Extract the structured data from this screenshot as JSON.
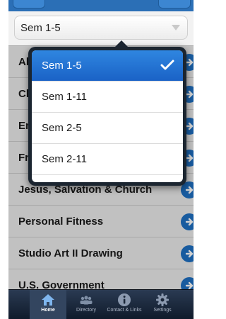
{
  "selector": {
    "value": "Sem 1-5"
  },
  "courses": [
    {
      "label": "Al"
    },
    {
      "label": "Ch"
    },
    {
      "label": "En"
    },
    {
      "label": "Fr"
    },
    {
      "label": "Jesus, Salvation & Church"
    },
    {
      "label": "Personal Fitness"
    },
    {
      "label": "Studio Art II Drawing"
    },
    {
      "label": "U.S. Government"
    }
  ],
  "dropdown": {
    "options": [
      {
        "label": "Sem 1-5",
        "selected": true
      },
      {
        "label": "Sem 1-11",
        "selected": false
      },
      {
        "label": "Sem 2-5",
        "selected": false
      },
      {
        "label": "Sem 2-11",
        "selected": false
      }
    ]
  },
  "tabbar": {
    "tabs": [
      {
        "label": "Home",
        "icon": "home-icon",
        "active": true
      },
      {
        "label": "Directory",
        "icon": "people-icon",
        "active": false
      },
      {
        "label": "Contact & Links",
        "icon": "info-icon",
        "active": false
      },
      {
        "label": "Settings",
        "icon": "gear-icon",
        "active": false
      }
    ]
  },
  "colors": {
    "accent": "#1e6fc2",
    "selected": "#2f86e0",
    "tabbar": "#1a2638"
  }
}
